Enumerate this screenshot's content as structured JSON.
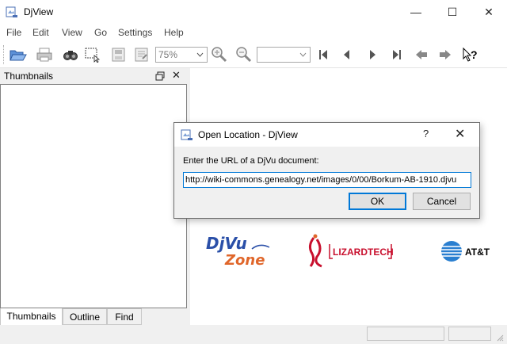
{
  "window": {
    "title": "DjView",
    "minimize_glyph": "—",
    "maximize_glyph": "☐",
    "close_glyph": "✕"
  },
  "menubar": {
    "items": [
      "File",
      "Edit",
      "View",
      "Go",
      "Settings",
      "Help"
    ]
  },
  "toolbar": {
    "zoom_value": "75%",
    "page_value": "",
    "icons": [
      "open-icon",
      "print-icon",
      "find-icon",
      "select-icon",
      "export-icon",
      "page-info-icon",
      "zoom-in-icon",
      "zoom-out-icon",
      "first-page-icon",
      "previous-page-icon",
      "next-page-icon",
      "last-page-icon",
      "back-icon",
      "forward-icon",
      "whats-this-icon"
    ]
  },
  "sidebar": {
    "title": "Thumbnails",
    "tabs": [
      "Thumbnails",
      "Outline",
      "Find"
    ],
    "active_tab": "Thumbnails"
  },
  "document": {
    "logos": [
      "DjVu Zone",
      "LIZARDTECH",
      "AT&T"
    ]
  },
  "dialog": {
    "title": "Open Location - DjView",
    "help_glyph": "?",
    "close_glyph": "✕",
    "prompt": "Enter the URL of a DjVu document:",
    "url_value": "http://wiki-commons.genealogy.net/images/0/00/Borkum-AB-1910.djvu",
    "ok_label": "OK",
    "cancel_label": "Cancel"
  },
  "colors": {
    "accent": "#0078d7",
    "lizardtech_red": "#c8102e",
    "djvu_blue": "#2a4fa8",
    "djvu_orange": "#e0662a"
  }
}
